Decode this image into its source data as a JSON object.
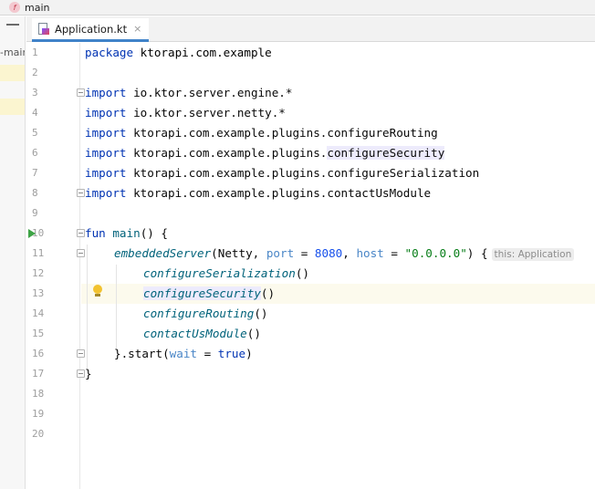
{
  "breadcrumb": {
    "icon": "kotlin-function-icon",
    "icon_glyph": "f",
    "label": "main"
  },
  "project_panel": {
    "label": "-main"
  },
  "tab": {
    "label": "Application.kt",
    "close": "×"
  },
  "code": {
    "line_numbers": [
      "1",
      "2",
      "3",
      "4",
      "5",
      "6",
      "7",
      "8",
      "9",
      "10",
      "11",
      "12",
      "13",
      "14",
      "15",
      "16",
      "17",
      "18",
      "19",
      "20"
    ],
    "l1_kw": "package",
    "l1_rest": " ktorapi.com.example",
    "l3_kw": "import",
    "l3_rest": " io.ktor.server.engine.*",
    "l4_kw": "import",
    "l4_rest": " io.ktor.server.netty.*",
    "l5_kw": "import",
    "l5_rest": " ktorapi.com.example.plugins.configureRouting",
    "l6_kw": "import",
    "l6_prefix": " ktorapi.com.example.plugins.",
    "l6_hl": "configureSecurity",
    "l7_kw": "import",
    "l7_rest": " ktorapi.com.example.plugins.configureSerialization",
    "l8_kw": "import",
    "l8_rest": " ktorapi.com.example.plugins.contactUsModule",
    "l10_kw": "fun",
    "l10_sp": " ",
    "l10_fn": "main",
    "l10_rest": "() {",
    "l11_fn": "embeddedServer",
    "l11_a": "(Netty, ",
    "l11_port": "port",
    "l11_eq1": " = ",
    "l11_num": "8080",
    "l11_b": ", ",
    "l11_host": "host",
    "l11_eq2": " = ",
    "l11_str": "\"0.0.0.0\"",
    "l11_c": ") {",
    "l11_hint": "this: Application",
    "l12_fn": "configureSerialization",
    "l12_rest": "()",
    "l13_fn": "configureSecurity",
    "l13_rest": "()",
    "l14_fn": "configureRouting",
    "l14_rest": "()",
    "l15_fn": "contactUsModule",
    "l15_rest": "()",
    "l16_a": "}.start(",
    "l16_wait": "wait",
    "l16_eq": " = ",
    "l16_true": "true",
    "l16_b": ")",
    "l17": "}"
  },
  "colors": {
    "keyword": "#0033b3",
    "function": "#00627a",
    "number": "#1750eb",
    "string": "#067d17",
    "named_arg": "#4a86c7",
    "run_icon": "#3da345",
    "tab_underline": "#4083c9"
  }
}
